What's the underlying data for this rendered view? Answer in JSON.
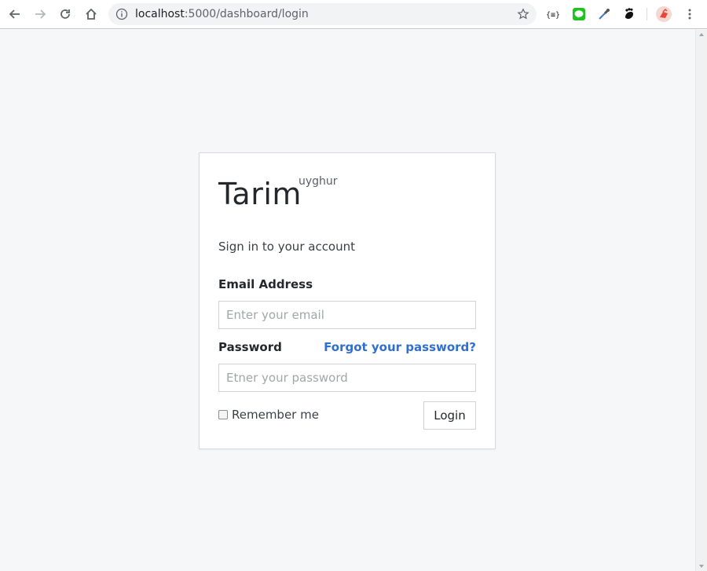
{
  "browser": {
    "url_host": "localhost",
    "url_rest": ":5000/dashboard/login",
    "extensions": [
      "json-viewer-extension",
      "line-extension",
      "color-picker-extension",
      "gnome-extension",
      "profile-avatar"
    ]
  },
  "login": {
    "brand": "Tarim",
    "brand_sup": "uyghur",
    "subtitle": "Sign in to your account",
    "email_label": "Email Address",
    "email_placeholder": "Enter your email",
    "password_label": "Password",
    "forgot_link": "Forgot your password?",
    "password_placeholder": "Etner your password",
    "remember_label": "Remember me",
    "login_button": "Login"
  },
  "colors": {
    "link": "#2f6fd0",
    "page_bg": "#f6f7f9"
  }
}
